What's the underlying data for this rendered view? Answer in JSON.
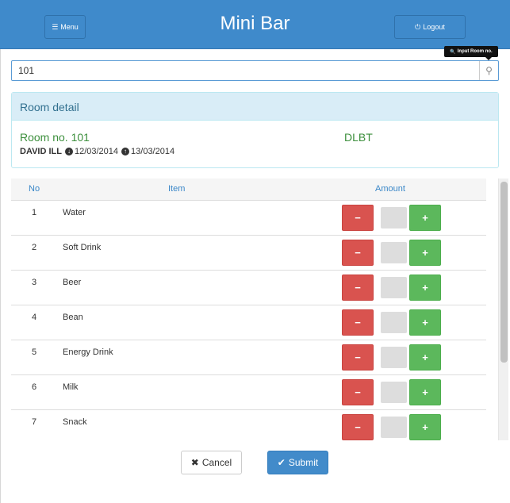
{
  "header": {
    "title": "Mini Bar",
    "menu_label": "Menu",
    "logout_label": "Logout",
    "menu_icon": "menu-bars-icon",
    "logout_icon": "power-icon",
    "color": "#3f8acb"
  },
  "search": {
    "value": "101",
    "tooltip": "Input Room no.",
    "icon": "search-icon"
  },
  "room_detail": {
    "heading": "Room detail",
    "room_no": "Room no. 101",
    "room_type": "DLBT",
    "guest": "DAVID ILL",
    "check_in": "12/03/2014",
    "check_out": "13/03/2014"
  },
  "table": {
    "headers": {
      "no": "No",
      "item": "Item",
      "amount": "Amount"
    },
    "rows": [
      {
        "no": "1",
        "item": "Water",
        "qty": ""
      },
      {
        "no": "2",
        "item": "Soft Drink",
        "qty": ""
      },
      {
        "no": "3",
        "item": "Beer",
        "qty": ""
      },
      {
        "no": "4",
        "item": "Bean",
        "qty": ""
      },
      {
        "no": "5",
        "item": "Energy Drink",
        "qty": ""
      },
      {
        "no": "6",
        "item": "Milk",
        "qty": ""
      },
      {
        "no": "7",
        "item": "Snack",
        "qty": ""
      }
    ],
    "minus_label": "−",
    "plus_label": "+"
  },
  "actions": {
    "cancel_label": "Cancel",
    "submit_label": "Submit"
  },
  "colors": {
    "danger": "#d9534f",
    "success": "#5cb85c",
    "primary": "#428bca"
  }
}
